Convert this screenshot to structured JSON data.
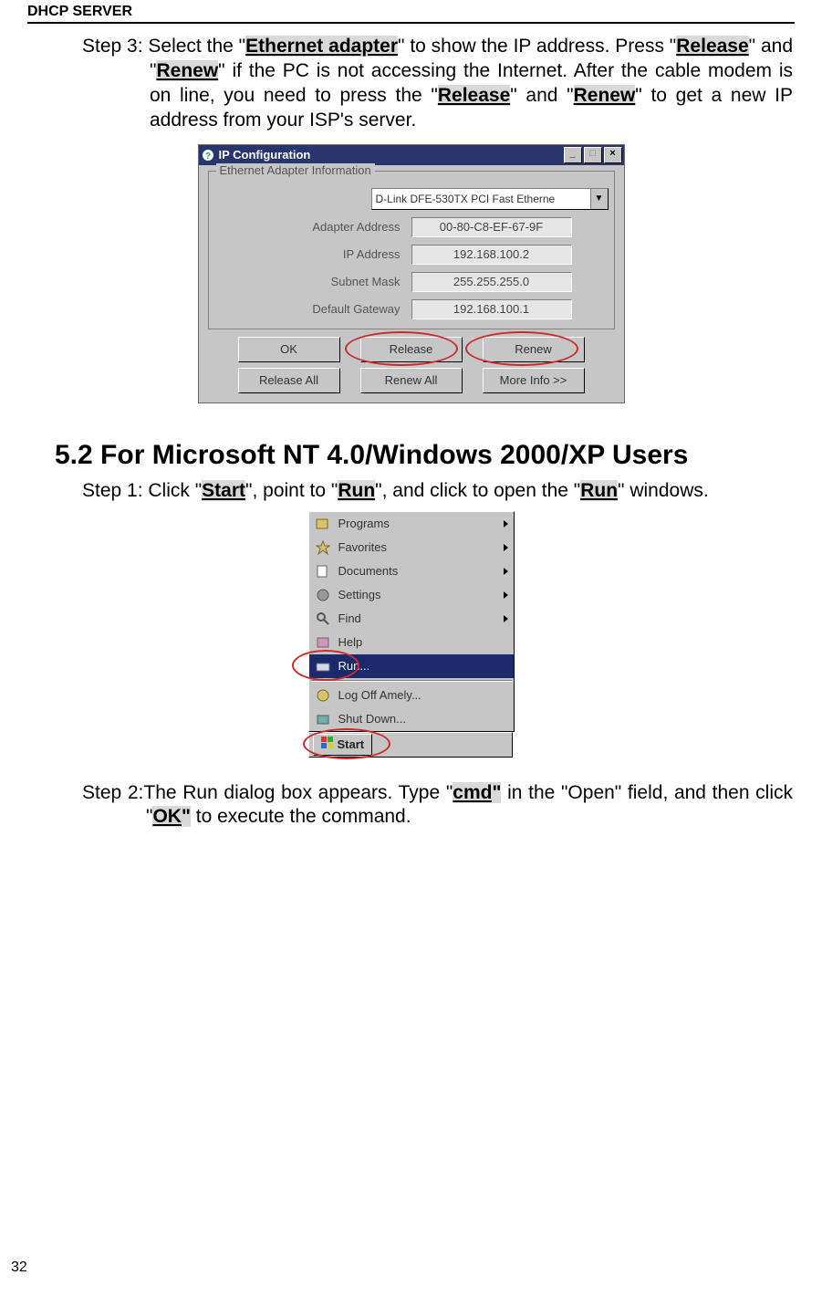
{
  "header": {
    "title": "DHCP SERVER"
  },
  "step3": {
    "label": "Step 3: ",
    "t1": "Select the \"",
    "hl1": "Ethernet adapter",
    "t2": "\" to show the IP address. Press \"",
    "hl2": "Release",
    "t3": "\" and \"",
    "hl3": "Renew",
    "t4": "\" if the PC is not accessing the Internet. After the cable modem is on line, you need to press the \"",
    "hl4": "Release",
    "t5": "\" and \"",
    "hl5": "Renew",
    "t6": "\" to get a new IP address from your ISP's server."
  },
  "ipconf": {
    "title": "IP Configuration",
    "group_label": "Ethernet Adapter Information",
    "adapter_selected": "D-Link DFE-530TX PCI Fast Etherne",
    "rows": [
      {
        "label": "Adapter Address",
        "value": "00-80-C8-EF-67-9F"
      },
      {
        "label": "IP Address",
        "value": "192.168.100.2"
      },
      {
        "label": "Subnet Mask",
        "value": "255.255.255.0"
      },
      {
        "label": "Default Gateway",
        "value": "192.168.100.1"
      }
    ],
    "buttons_row1": {
      "ok": "OK",
      "release": "Release",
      "renew": "Renew"
    },
    "buttons_row2": {
      "release_all": "Release All",
      "renew_all": "Renew All",
      "more": "More Info >>"
    }
  },
  "section": {
    "title": "5.2 For Microsoft NT 4.0/Windows 2000/XP Users"
  },
  "step1": {
    "t1": "Step 1: Click \"",
    "hl1": "Start",
    "t2": "\", point to \"",
    "hl2": "Run",
    "t3": "\", and click to open the \"",
    "hl3": "Run",
    "t4": "\" windows."
  },
  "startmenu": {
    "items": [
      {
        "label": "Programs",
        "arrow": true
      },
      {
        "label": "Favorites",
        "arrow": true
      },
      {
        "label": "Documents",
        "arrow": true
      },
      {
        "label": "Settings",
        "arrow": true
      },
      {
        "label": "Find",
        "arrow": true
      },
      {
        "label": "Help",
        "arrow": false
      },
      {
        "label": "Run...",
        "arrow": false,
        "selected": true
      },
      {
        "label": "Log Off Amely...",
        "arrow": false
      },
      {
        "label": "Shut Down...",
        "arrow": false
      }
    ],
    "start_button": "Start"
  },
  "step2": {
    "t1": "Step 2:The Run dialog box appears. Type \"",
    "hl1": "cmd",
    "q1": "\"",
    "t2": " in the \"Open\" field, and then click \"",
    "hl2": "OK",
    "q2": "\"",
    "t3": " to execute the command."
  },
  "page_number": "32"
}
